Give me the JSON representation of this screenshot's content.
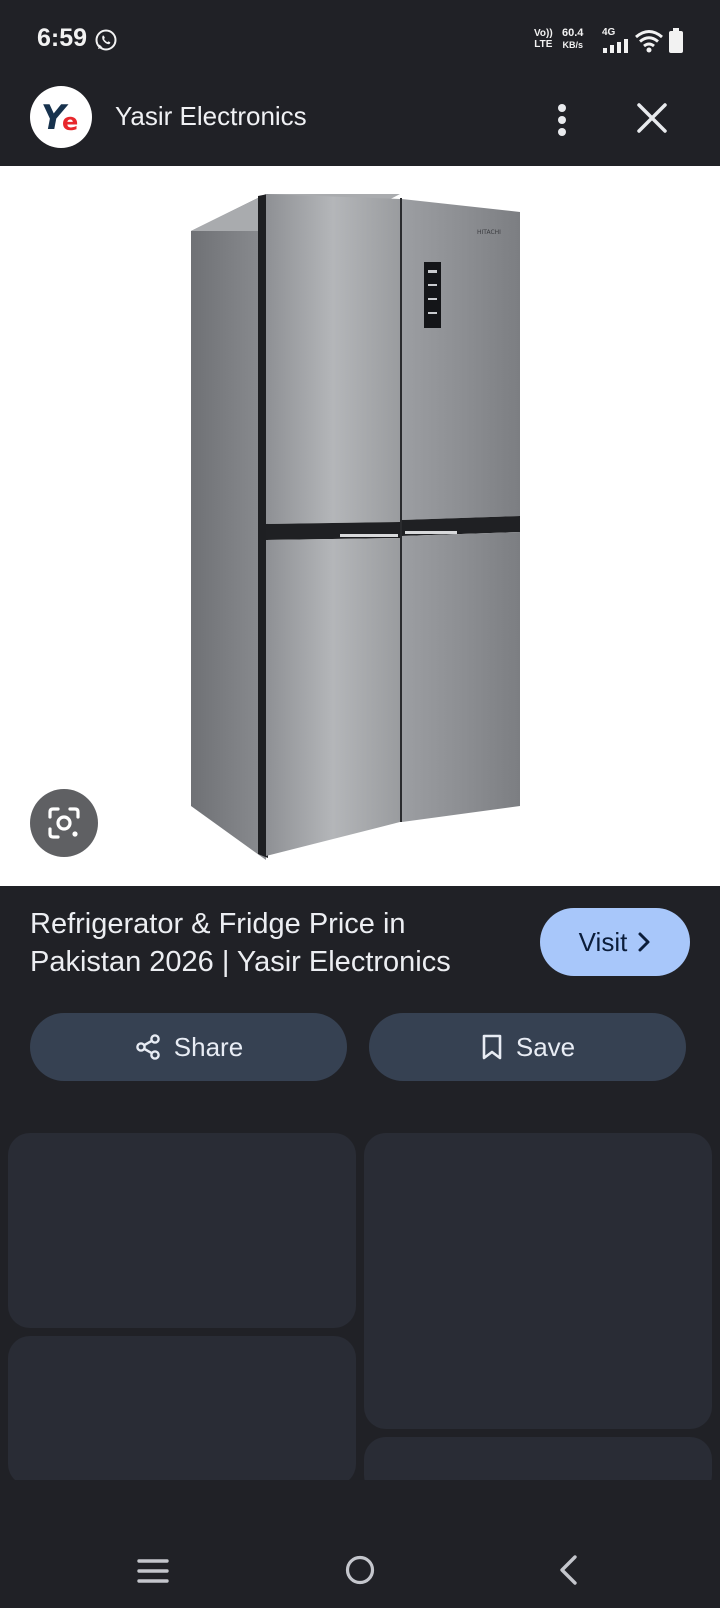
{
  "status_bar": {
    "time": "6:59",
    "volte_top": "Vo))",
    "volte_bottom": "LTE",
    "speed_value": "60.4",
    "speed_unit": "KB/s",
    "network": "4G",
    "icons": [
      "whatsapp-icon",
      "signal-icon",
      "wifi-icon",
      "battery-icon"
    ]
  },
  "header": {
    "logo_letter_1": "Y",
    "logo_letter_2": "e",
    "site_name": "Yasir Electronics",
    "icons": [
      "more-vert-icon",
      "close-icon"
    ]
  },
  "image": {
    "brand_text": "HITACHI",
    "lens_icon": "google-lens-icon"
  },
  "result": {
    "title": "Refrigerator & Fridge Price in Pakistan 2026 | Yasir Electronics",
    "visit_label": "Visit",
    "share_label": "Share",
    "save_label": "Save"
  },
  "colors": {
    "background": "#202126",
    "visit_button": "#a8c7fa",
    "action_button": "#364152",
    "skeleton_card": "#292c35"
  },
  "nav_bar": {
    "icons": [
      "recents-icon",
      "home-icon",
      "back-icon"
    ]
  }
}
